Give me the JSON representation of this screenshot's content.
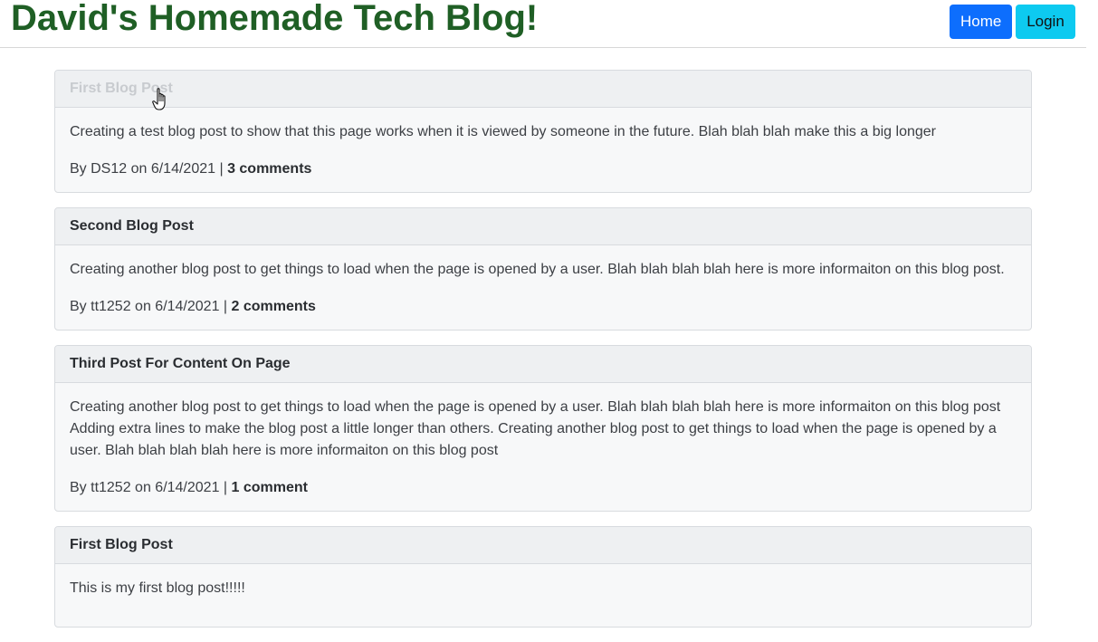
{
  "header": {
    "title": "David's Homemade Tech Blog!",
    "home_label": "Home",
    "login_label": "Login"
  },
  "posts": [
    {
      "title": "First Blog Post",
      "body": "Creating a test blog post to show that this page works when it is viewed by someone in the future. Blah blah blah make this a big longer",
      "byline": "By DS12 on 6/14/2021 | ",
      "comments": "3 comments"
    },
    {
      "title": "Second Blog Post",
      "body": "Creating another blog post to get things to load when the page is opened by a user. Blah blah blah blah here is more informaiton on this blog post.",
      "byline": "By tt1252 on 6/14/2021 | ",
      "comments": "2 comments"
    },
    {
      "title": "Third Post For Content On Page",
      "body": "Creating another blog post to get things to load when the page is opened by a user. Blah blah blah blah here is more informaiton on this blog post Adding extra lines to make the blog post a little longer than others. Creating another blog post to get things to load when the page is opened by a user. Blah blah blah blah here is more informaiton on this blog post",
      "byline": "By tt1252 on 6/14/2021 | ",
      "comments": "1 comment"
    },
    {
      "title": "First Blog Post",
      "body": "This is my first blog post!!!!!",
      "byline": "",
      "comments": ""
    }
  ],
  "colors": {
    "title_green": "#1f5f25",
    "home_blue": "#0d6efd",
    "login_cyan": "#0dcaf0"
  },
  "icons": {
    "cursor": "hand-pointer-cursor-icon"
  }
}
